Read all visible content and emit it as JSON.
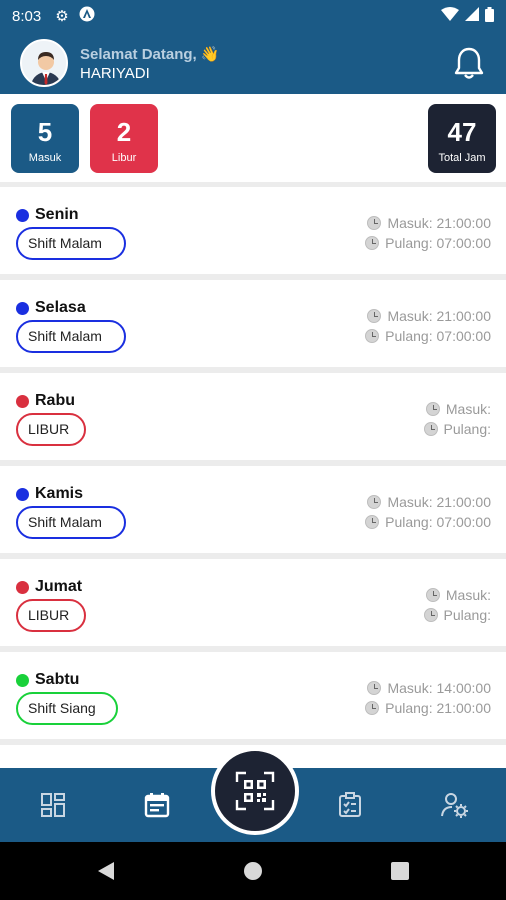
{
  "status_bar": {
    "time": "8:03"
  },
  "header": {
    "greeting": "Selamat Datang, 👋",
    "username": "HARIYADI"
  },
  "stats": [
    {
      "value": "5",
      "label": "Masuk",
      "color": "#1b5a86"
    },
    {
      "value": "2",
      "label": "Libur",
      "color": "#e0334a"
    },
    {
      "value": "47",
      "label": "Total Jam",
      "color": "#1d2333"
    }
  ],
  "schedule": [
    {
      "day": "Senin",
      "shift": "Shift Malam",
      "masuk": "Masuk: 21:00:00",
      "pulang": "Pulang: 07:00:00",
      "color": "#1a2fe0"
    },
    {
      "day": "Selasa",
      "shift": "Shift Malam",
      "masuk": "Masuk: 21:00:00",
      "pulang": "Pulang: 07:00:00",
      "color": "#1a2fe0"
    },
    {
      "day": "Rabu",
      "shift": "LIBUR",
      "masuk": "Masuk:",
      "pulang": "Pulang:",
      "color": "#d9303f"
    },
    {
      "day": "Kamis",
      "shift": "Shift Malam",
      "masuk": "Masuk: 21:00:00",
      "pulang": "Pulang: 07:00:00",
      "color": "#1a2fe0"
    },
    {
      "day": "Jumat",
      "shift": "LIBUR",
      "masuk": "Masuk:",
      "pulang": "Pulang:",
      "color": "#d9303f"
    },
    {
      "day": "Sabtu",
      "shift": "Shift Siang",
      "masuk": "Masuk: 14:00:00",
      "pulang": "Pulang: 21:00:00",
      "color": "#19d13a"
    }
  ],
  "nav": [
    "dashboard-icon",
    "calendar-icon",
    "qr-scan-icon",
    "clipboard-icon",
    "user-settings-icon"
  ]
}
